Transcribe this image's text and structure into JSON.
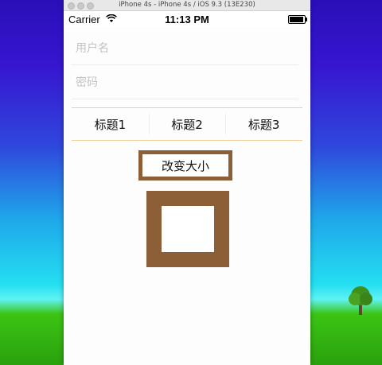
{
  "window": {
    "title": "iPhone 4s - iPhone 4s / iOS 9.3 (13E230)"
  },
  "status_bar": {
    "carrier": "Carrier",
    "time": "11:13 PM",
    "battery_level": 0.95
  },
  "form": {
    "username_placeholder": "用户名",
    "password_placeholder": "密码",
    "username_value": "",
    "password_value": ""
  },
  "tabs": [
    {
      "label": "标题1"
    },
    {
      "label": "标题2"
    },
    {
      "label": "标题3"
    }
  ],
  "change_size_button": {
    "label": "改变大小"
  },
  "colors": {
    "accent_brown": "#8d5f36",
    "tab_border": "#f2cf9a"
  },
  "icons": {
    "wifi": "wifi-icon",
    "battery": "battery-icon"
  }
}
